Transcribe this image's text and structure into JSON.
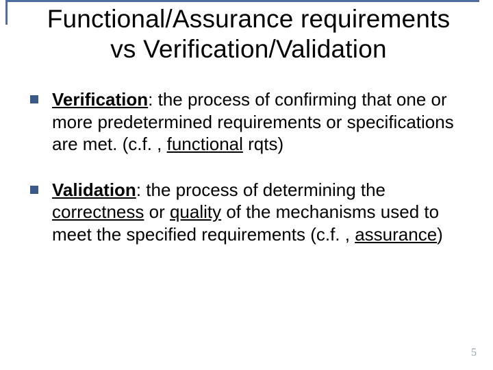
{
  "title": {
    "line1": "Functional/Assurance requirements",
    "line2": "vs Verification/Validation"
  },
  "bullets": [
    {
      "lead": "Verification",
      "colon": ": ",
      "body1": "the process of confirming that one or more predetermined requirements or specifications are met. (c.f. , ",
      "u1": "functional",
      "body2": " rqts)"
    },
    {
      "lead": "Validation",
      "colon": ": ",
      "body1": "the process of determining the ",
      "u1": "correctness",
      "body2": " or ",
      "u2": "quality",
      "body3": " of the mechanisms used to meet the specified requirements (c.f. , ",
      "u3": "assurance",
      "body4": ")"
    }
  ],
  "page_number": "5"
}
